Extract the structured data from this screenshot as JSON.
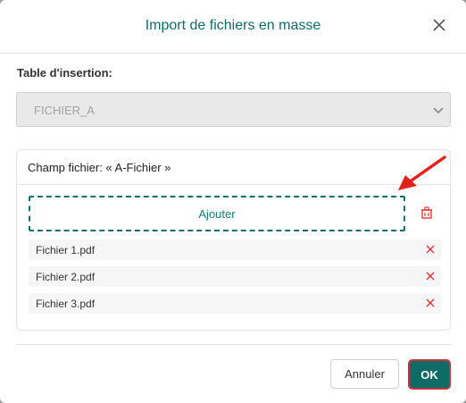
{
  "dialog": {
    "title": "Import de fichiers en masse",
    "close_icon": "close-icon"
  },
  "table_field": {
    "label": "Table d'insertion:",
    "selected_value": "FICHIER_A",
    "disabled": true
  },
  "file_panel": {
    "title": "Champ fichier: « A-Fichier »",
    "add_label": "Ajouter",
    "delete_all_icon": "delete-icon",
    "files": [
      {
        "name": "Fichier 1.pdf"
      },
      {
        "name": "Fichier 2.pdf"
      },
      {
        "name": "Fichier 3.pdf"
      }
    ],
    "remove_icon": "remove-icon"
  },
  "footer": {
    "cancel_label": "Annuler",
    "ok_label": "OK"
  },
  "colors": {
    "accent": "#0f6b66",
    "danger": "#e03b3b",
    "highlight_border": "#c8323a",
    "annotation_arrow": "#e5211b"
  }
}
